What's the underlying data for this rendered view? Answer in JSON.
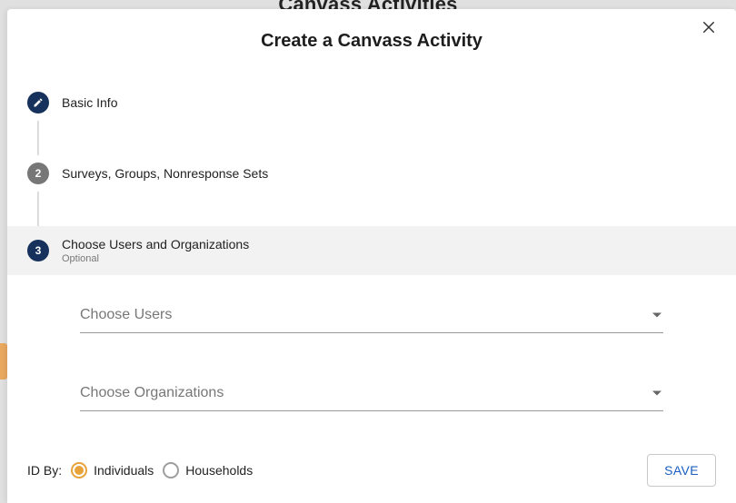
{
  "bg_title": "Canvass Activities",
  "modal": {
    "title": "Create a Canvass Activity",
    "close_aria": "Close"
  },
  "steps": [
    {
      "label": "Basic Info",
      "state": "done"
    },
    {
      "label": "Surveys, Groups, Nonresponse Sets",
      "state": "pending",
      "number": "2"
    },
    {
      "label": "Choose Users and Organizations",
      "sub": "Optional",
      "state": "active",
      "number": "3"
    }
  ],
  "fields": {
    "choose_users": {
      "placeholder": "Choose Users"
    },
    "choose_orgs": {
      "placeholder": "Choose Organizations"
    }
  },
  "id_by": {
    "label": "ID By:",
    "options": [
      {
        "label": "Individuals",
        "selected": true
      },
      {
        "label": "Households",
        "selected": false
      }
    ]
  },
  "actions": {
    "save": "SAVE"
  },
  "colors": {
    "step_active_bg": "#16325c",
    "step_pending_bg": "#777777",
    "accent_orange": "#e8a23a",
    "save_text": "#1b5fc1"
  }
}
